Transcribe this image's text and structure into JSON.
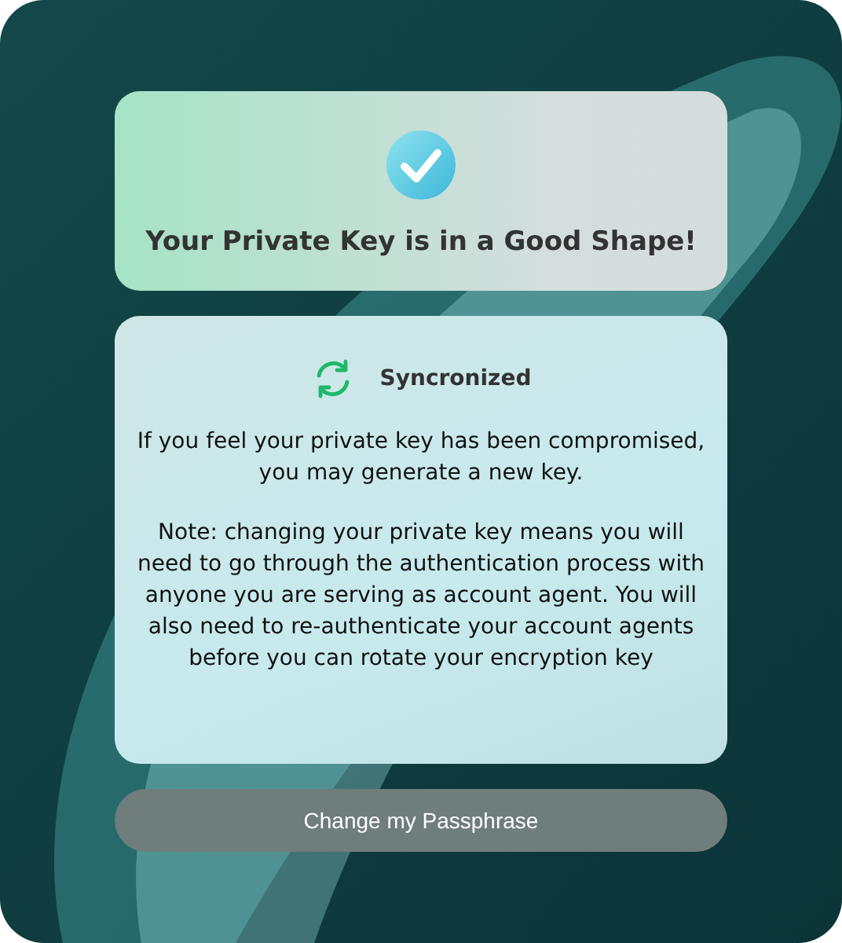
{
  "status_card": {
    "title": "Your Private Key is in a Good Shape!"
  },
  "sync_card": {
    "status": "Syncronized",
    "message": "If you feel your private key has been compromised, you may generate a new key.",
    "note": "Note: changing your private key means you will need to go through the authentication process with anyone you are serving as account agent. You will also need to re-authenticate your account agents before you can rotate your encryption key"
  },
  "button": {
    "label": "Change my Passphrase"
  }
}
